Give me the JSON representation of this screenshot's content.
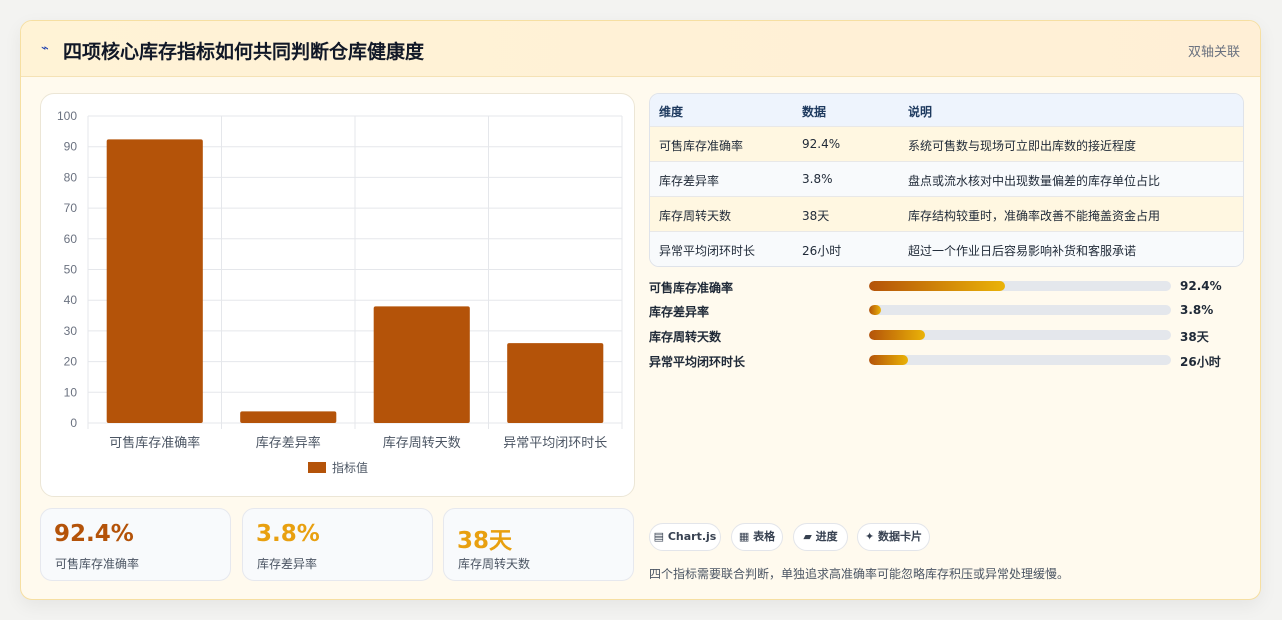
{
  "header": {
    "icon": "bolt-icon",
    "title": "四项核心库存指标如何共同判断仓库健康度",
    "tag": "双轴关联"
  },
  "chart_data": {
    "type": "bar",
    "categories": [
      "可售库存准确率",
      "库存差异率",
      "库存周转天数",
      "异常平均闭环时长"
    ],
    "series": [
      {
        "name": "指标值",
        "values": [
          92.4,
          3.8,
          38,
          26
        ],
        "color": "#b45309"
      }
    ],
    "ylim": [
      0,
      100
    ],
    "yticks": [
      0,
      10,
      20,
      30,
      40,
      50,
      60,
      70,
      80,
      90,
      100
    ],
    "grid": true,
    "legend": "bottom"
  },
  "stats": [
    {
      "value": "92.4%",
      "label": "可售库存准确率",
      "color": "#b45309"
    },
    {
      "value": "3.8%",
      "label": "库存差异率",
      "color": "#e8a010"
    },
    {
      "value": "38天",
      "label": "库存周转天数",
      "color": "#e8a010"
    }
  ],
  "table": {
    "headers": [
      "维度",
      "数据",
      "说明"
    ],
    "rows": [
      [
        "可售库存准确率",
        "92.4%",
        "系统可售数与现场可立即出库数的接近程度"
      ],
      [
        "库存差异率",
        "3.8%",
        "盘点或流水核对中出现数量偏差的库存单位占比"
      ],
      [
        "库存周转天数",
        "38天",
        "库存结构较重时，准确率改善不能掩盖资金占用"
      ],
      [
        "异常平均闭环时长",
        "26小时",
        "超过一个作业日后容易影响补货和客服承诺"
      ]
    ]
  },
  "progress": [
    {
      "label": "可售库存准确率",
      "value": "92.4%",
      "fraction": 0.45
    },
    {
      "label": "库存差异率",
      "value": "3.8%",
      "fraction": 0.04
    },
    {
      "label": "库存周转天数",
      "value": "38天",
      "fraction": 0.185
    },
    {
      "label": "异常平均闭环时长",
      "value": "26小时",
      "fraction": 0.13
    }
  ],
  "chips": [
    {
      "label": "▤ Chart.js"
    },
    {
      "label": "▦ 表格"
    },
    {
      "label": "▰ 进度"
    },
    {
      "label": "✦ 数据卡片"
    }
  ],
  "note": "四个指标需要联合判断，单独追求高准确率可能忽略库存积压或异常处理缓慢。",
  "colors": {
    "bar": "#b45309",
    "accent": "#eab308",
    "background": "#fffaee"
  }
}
